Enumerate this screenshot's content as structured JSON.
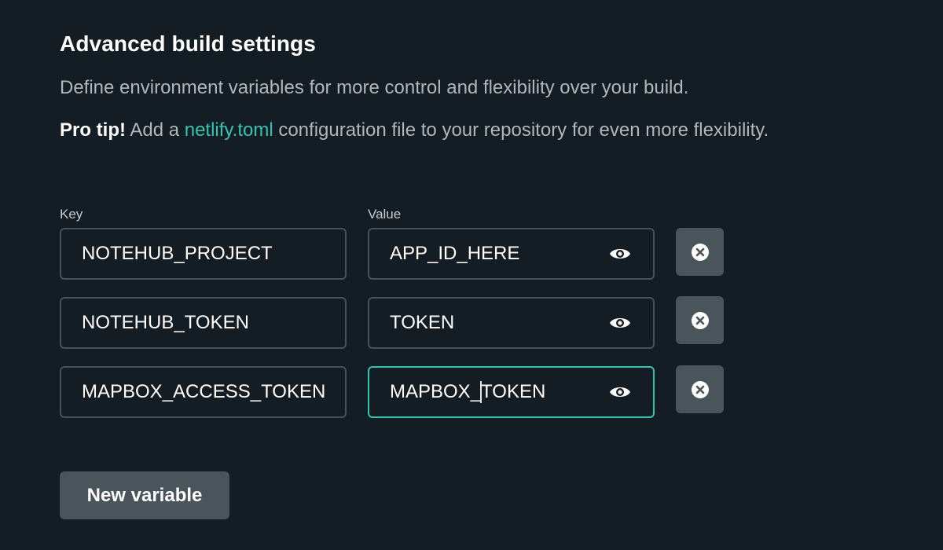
{
  "section": {
    "title": "Advanced build settings",
    "description": "Define environment variables for more control and flexibility over your build.",
    "tip_prefix": "Pro tip!",
    "tip_before_link": " Add a ",
    "tip_link": "netlify.toml",
    "tip_after_link": " configuration file to your repository for even more flexibility."
  },
  "columns": {
    "key_label": "Key",
    "value_label": "Value"
  },
  "variables": [
    {
      "key": "NOTEHUB_PROJECT",
      "value": "APP_ID_HERE"
    },
    {
      "key": "NOTEHUB_TOKEN",
      "value": "TOKEN"
    },
    {
      "key": "MAPBOX_ACCESS_TOKEN",
      "value_before_caret": "MAPBOX_",
      "value_after_caret": "TOKEN"
    }
  ],
  "actions": {
    "new_variable_label": "New variable"
  },
  "colors": {
    "background": "#141d23",
    "accent": "#32c4b4",
    "button_bg": "#4a545b",
    "field_border": "#485158"
  },
  "icons": {
    "reveal": "eye-icon",
    "remove": "close-circle-icon"
  }
}
